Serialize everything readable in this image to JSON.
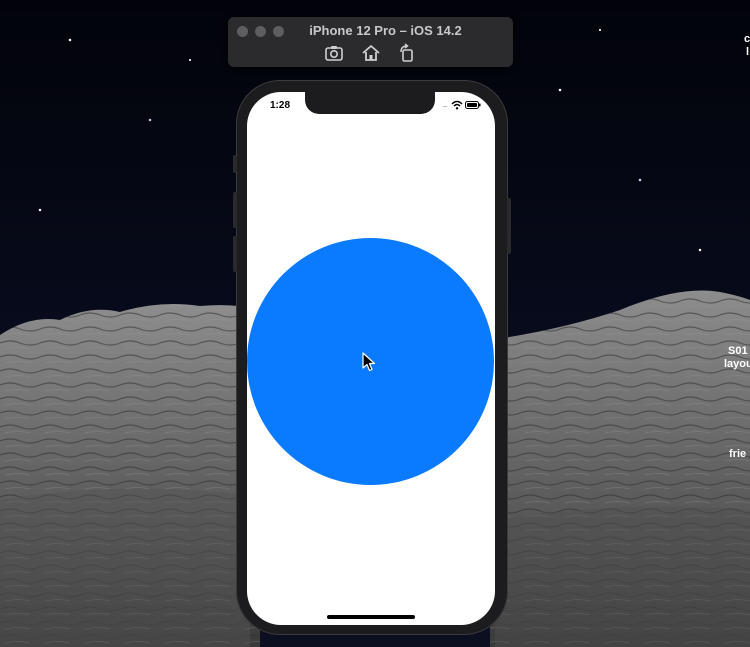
{
  "simulator": {
    "title": "iPhone 12 Pro – iOS 14.2",
    "toolbar": [
      {
        "icon": "screenshot-icon"
      },
      {
        "icon": "home-icon"
      },
      {
        "icon": "rotate-icon"
      }
    ]
  },
  "status_bar": {
    "time": "1:28",
    "signal_dots": "....",
    "wifi_icon": "wifi-icon",
    "battery_icon": "battery-icon"
  },
  "app": {
    "circle_color": "#0a7aff",
    "background_color": "#ffffff"
  },
  "desktop_edge_text": {
    "line1": "c",
    "line2": "l",
    "line3": "S01",
    "line4": "layou",
    "line5": "frie"
  }
}
